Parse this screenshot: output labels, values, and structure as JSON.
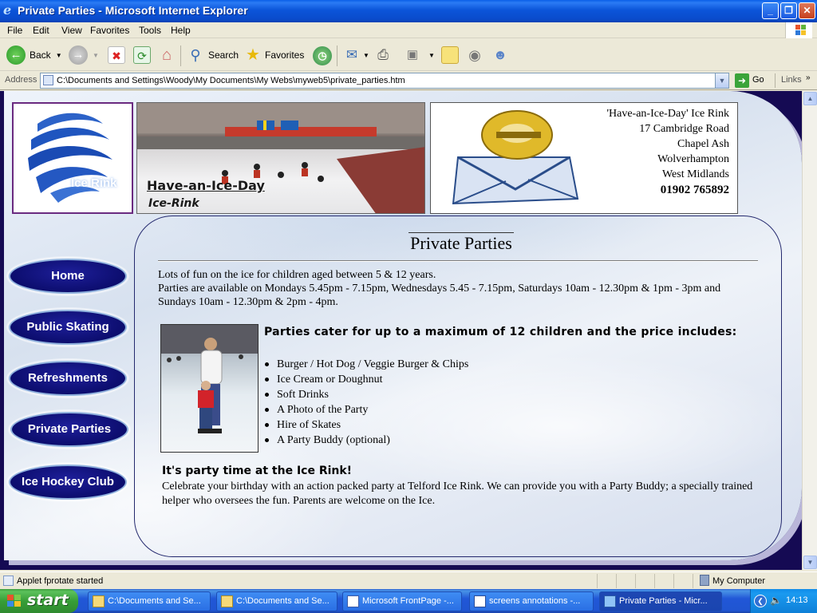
{
  "window": {
    "title": "Private Parties - Microsoft Internet Explorer",
    "minimize": "_",
    "restore": "❐",
    "close": "✕"
  },
  "menu": [
    "File",
    "Edit",
    "View",
    "Favorites",
    "Tools",
    "Help"
  ],
  "toolbar": {
    "back": "Back",
    "search": "Search",
    "favorites": "Favorites"
  },
  "address": {
    "label": "Address",
    "url": "C:\\Documents and Settings\\Woody\\My Documents\\My Webs\\myweb5\\private_parties.htm",
    "go": "Go",
    "links": "Links"
  },
  "header": {
    "logo_text": "Ice Rink",
    "banner_line1": "Have-an-Ice-Day",
    "banner_line2": "Ice-Rink",
    "contact": {
      "name": "'Have-an-Ice-Day' Ice Rink",
      "street": "17 Cambridge Road",
      "area": "Chapel Ash",
      "town": "Wolverhampton",
      "county": "West Midlands",
      "phone": "01902 765892"
    }
  },
  "nav": [
    {
      "label": "Home"
    },
    {
      "label": "Public Skating"
    },
    {
      "label": "Refreshments"
    },
    {
      "label": "Private Parties"
    },
    {
      "label": "Ice Hockey Club"
    }
  ],
  "content": {
    "title": "Private Parties",
    "intro1": "Lots of fun on the ice for children aged between 5 & 12 years.",
    "intro2": "Parties are available on Mondays 5.45pm - 7.15pm, Wednesdays 5.45 - 7.15pm, Saturdays 10am - 12.30pm & 1pm - 3pm and Sundays 10am - 12.30pm & 2pm - 4pm.",
    "includes_heading": "Parties cater for up to a maximum of 12 children and the price includes:",
    "includes": [
      "Burger / Hot Dog / Veggie Burger & Chips",
      "Ice Cream or Doughnut",
      "Soft Drinks",
      "A Photo of the Party",
      "Hire of Skates",
      "A Party Buddy (optional)"
    ],
    "party_heading": "It's party time at the Ice Rink!",
    "party_text": "Celebrate your birthday with an action packed party at Telford Ice Rink. We can provide you with a Party Buddy; a specially trained helper who oversees the fun. Parents are welcome on the Ice."
  },
  "status": {
    "message": "Applet fprotate started",
    "zone": "My Computer"
  },
  "taskbar": {
    "start": "start",
    "tasks": [
      "C:\\Documents and Se...",
      "C:\\Documents and Se...",
      "Microsoft FrontPage -...",
      "screens annotations -...",
      "Private Parties - Micr..."
    ],
    "clock": "14:13"
  }
}
